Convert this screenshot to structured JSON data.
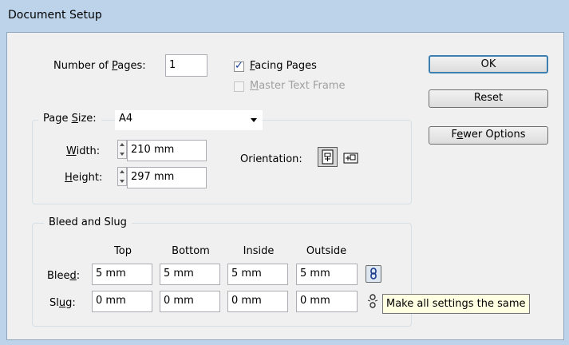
{
  "window": {
    "title": "Document Setup"
  },
  "pages": {
    "number_label_pre": "Number of ",
    "number_label_u": "P",
    "number_label_post": "ages:",
    "number_value": "1",
    "facing_pre": "",
    "facing_u": "F",
    "facing_post": "acing Pages",
    "facing_checked": true,
    "master_pre": "",
    "master_u": "M",
    "master_post": "aster Text Frame",
    "master_checked": false
  },
  "page_size": {
    "label_pre": "Page ",
    "label_u": "S",
    "label_post": "ize:",
    "value": "A4",
    "width_label_u": "W",
    "width_label_post": "idth:",
    "width_value": "210 mm",
    "height_label_u": "H",
    "height_label_post": "eight:",
    "height_value": "297 mm",
    "orientation_label": "Orientation:"
  },
  "bleed_slug": {
    "legend": "Bleed and Slug",
    "headers": [
      "Top",
      "Bottom",
      "Inside",
      "Outside"
    ],
    "bleed_label_pre": "Blee",
    "bleed_label_u": "d",
    "bleed_label_post": ":",
    "bleed_values": [
      "5 mm",
      "5 mm",
      "5 mm",
      "5 mm"
    ],
    "slug_label_pre": "Sl",
    "slug_label_u": "u",
    "slug_label_post": "g:",
    "slug_values": [
      "0 mm",
      "0 mm",
      "0 mm",
      "0 mm"
    ],
    "tooltip": "Make all settings the same"
  },
  "buttons": {
    "ok": "OK",
    "reset": "Reset",
    "fewer_pre": "F",
    "fewer_u": "e",
    "fewer_post": "wer Options"
  },
  "colors": {
    "title_bar": "#bcd3ea",
    "dialog_bg": "#f0f0f0",
    "tooltip_bg": "#ffffe1",
    "default_button_border": "#3c7fb1"
  }
}
